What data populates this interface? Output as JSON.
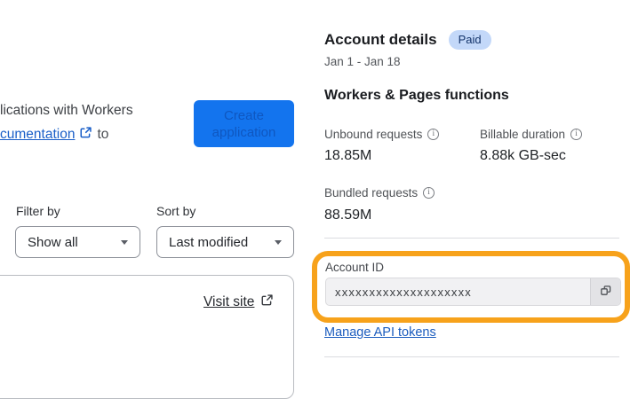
{
  "left_panel": {
    "intro_line1": "lications with Workers",
    "intro_link_text": "cumentation",
    "intro_suffix": "to",
    "create_button_label": "Create application",
    "filter": {
      "label": "Filter by",
      "value": "Show all"
    },
    "sort": {
      "label": "Sort by",
      "value": "Last modified"
    },
    "visit_site_label": "Visit site"
  },
  "account_details": {
    "title": "Account details",
    "plan_badge": "Paid",
    "date_range": "Jan 1 - Jan 18",
    "section_title": "Workers & Pages functions",
    "stats": [
      {
        "label": "Unbound requests",
        "value": "18.85M"
      },
      {
        "label": "Billable duration",
        "value": "8.88k GB-sec"
      },
      {
        "label": "Bundled requests",
        "value": "88.59M"
      }
    ],
    "account_id": {
      "label": "Account ID",
      "value": "xxxxxxxxxxxxxxxxxxxx"
    },
    "manage_tokens_label": "Manage API tokens"
  },
  "colors": {
    "primary_blue": "#1374ee",
    "link_blue": "#1b5cbe",
    "doc_link_blue": "#1a5fc8",
    "badge_bg": "#c3d8f9",
    "badge_text": "#15356b",
    "highlight_orange": "#f7a21b"
  }
}
